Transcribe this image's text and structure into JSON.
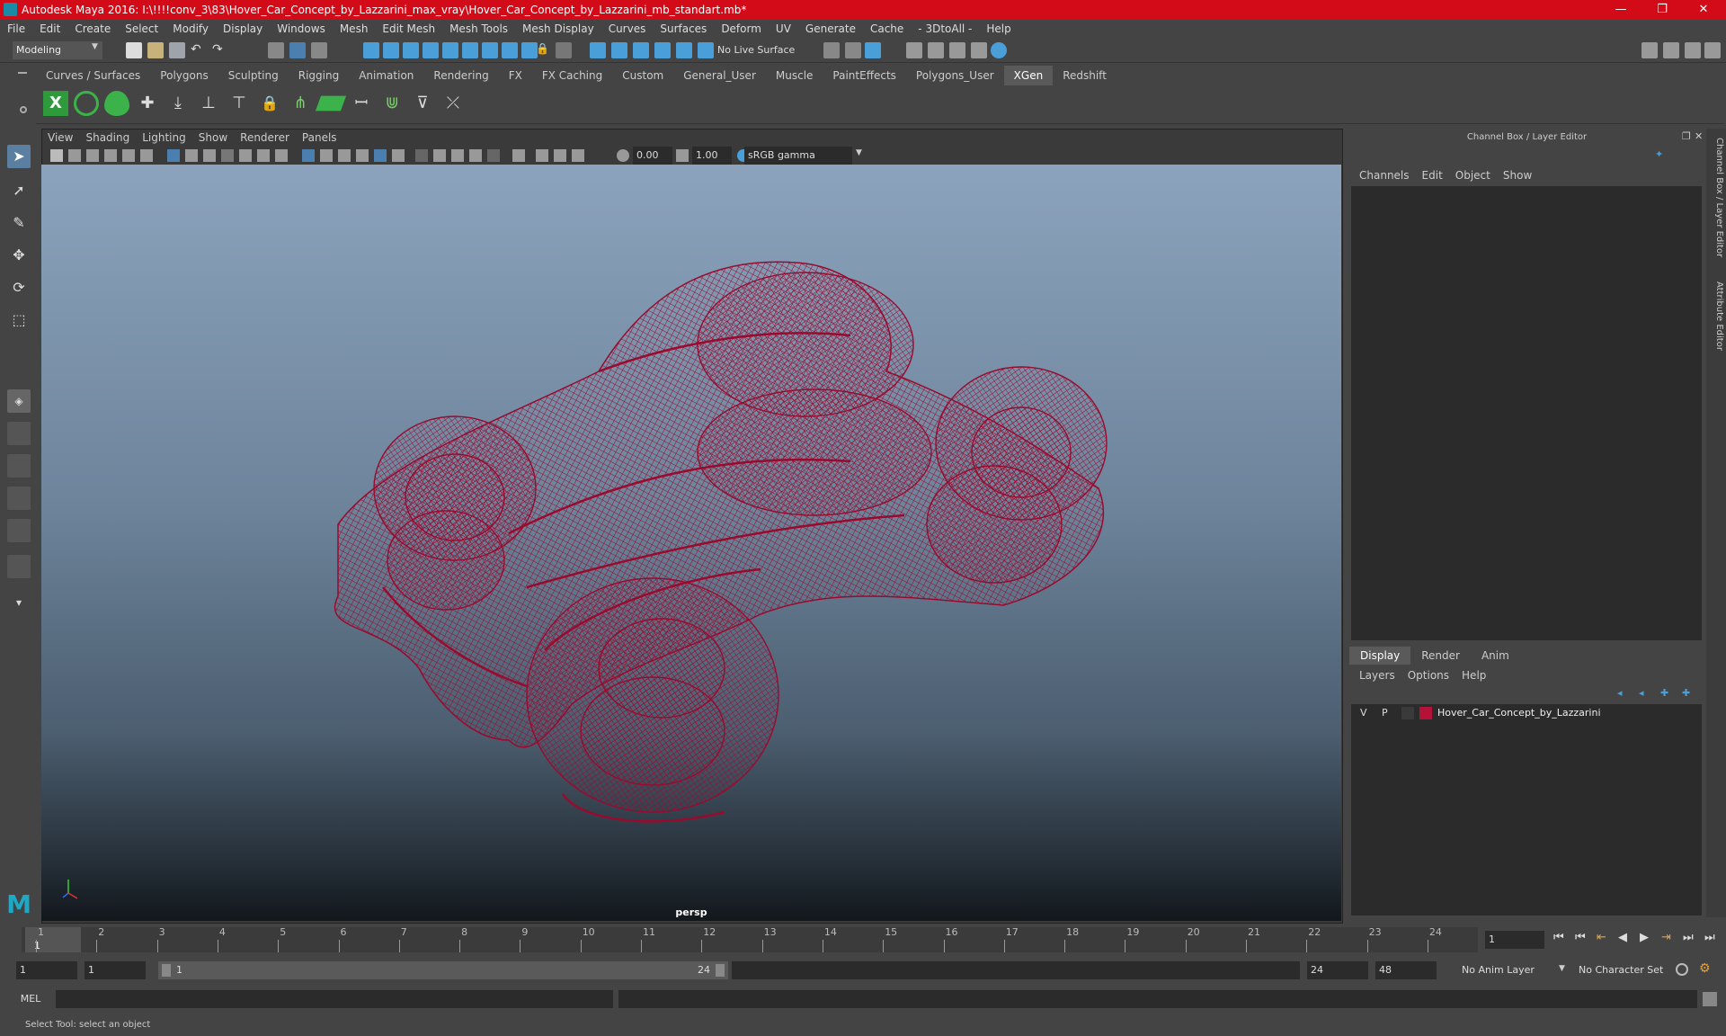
{
  "window": {
    "title": "Autodesk Maya 2016: I:\\!!!!conv_3\\83\\Hover_Car_Concept_by_Lazzarini_max_vray\\Hover_Car_Concept_by_Lazzarini_mb_standart.mb*"
  },
  "menu": [
    "File",
    "Edit",
    "Create",
    "Select",
    "Modify",
    "Display",
    "Windows",
    "Mesh",
    "Edit Mesh",
    "Mesh Tools",
    "Mesh Display",
    "Curves",
    "Surfaces",
    "Deform",
    "UV",
    "Generate",
    "Cache",
    "- 3DtoAll -",
    "Help"
  ],
  "status": {
    "mode": "Modeling",
    "live_surface": "No Live Surface"
  },
  "shelf_tabs": [
    "Curves / Surfaces",
    "Polygons",
    "Sculpting",
    "Rigging",
    "Animation",
    "Rendering",
    "FX",
    "FX Caching",
    "Custom",
    "General_User",
    "Muscle",
    "PaintEffects",
    "Polygons_User",
    "XGen",
    "Redshift"
  ],
  "shelf_active": "XGen",
  "viewport": {
    "menu": [
      "View",
      "Shading",
      "Lighting",
      "Show",
      "Renderer",
      "Panels"
    ],
    "exposure": "0.00",
    "gamma": "1.00",
    "color_space": "sRGB gamma",
    "camera_label": "persp"
  },
  "channel_box": {
    "title": "Channel Box / Layer Editor",
    "menu": [
      "Channels",
      "Edit",
      "Object",
      "Show"
    ]
  },
  "layer_editor": {
    "tabs": [
      "Display",
      "Render",
      "Anim"
    ],
    "active_tab": "Display",
    "menu": [
      "Layers",
      "Options",
      "Help"
    ],
    "layers": [
      {
        "v": "V",
        "p": "P",
        "name": "Hover_Car_Concept_by_Lazzarini",
        "color": "#b5123a"
      }
    ]
  },
  "side_tabs": [
    "Channel Box / Layer Editor",
    "Attribute Editor"
  ],
  "timeline": {
    "ticks": [
      "1",
      "2",
      "3",
      "4",
      "5",
      "6",
      "7",
      "8",
      "9",
      "10",
      "11",
      "12",
      "13",
      "14",
      "15",
      "16",
      "17",
      "18",
      "19",
      "20",
      "21",
      "22",
      "23",
      "24"
    ],
    "current_frame_marker": "1",
    "current_frame": "1"
  },
  "range": {
    "start": "1",
    "playback_start": "1",
    "slider_start": "1",
    "slider_end": "24",
    "playback_end": "24",
    "end": "48",
    "anim_layer": "No Anim Layer",
    "character_set": "No Character Set"
  },
  "command": {
    "lang": "MEL"
  },
  "help_line": "Select Tool: select an object",
  "colors": {
    "accent": "#d30a18",
    "wireframe": "#9a0a2e",
    "highlight": "#4a9fd8"
  }
}
